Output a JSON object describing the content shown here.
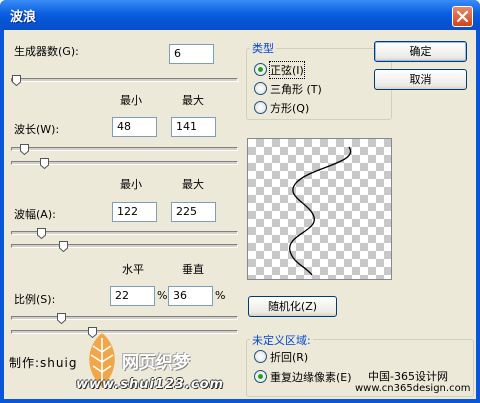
{
  "window": {
    "title": "波浪",
    "close_label": "X"
  },
  "generators": {
    "label": "生成器数(G):",
    "value": "6"
  },
  "headers": {
    "min": "最小",
    "max": "最大",
    "horizontal": "水平",
    "vertical": "垂直"
  },
  "wavelength": {
    "label": "波长(W):",
    "min": "48",
    "max": "141"
  },
  "amplitude": {
    "label": "波幅(A):",
    "min": "122",
    "max": "225"
  },
  "scale": {
    "label": "比例(S):",
    "horizontal": "22",
    "vertical": "36",
    "unit": "%"
  },
  "type_group": {
    "legend": "类型",
    "options": [
      {
        "label": "正弦(I)",
        "selected": true
      },
      {
        "label": "三角形 (T)",
        "selected": false
      },
      {
        "label": "方形(Q)",
        "selected": false
      }
    ]
  },
  "buttons": {
    "ok": "确定",
    "cancel": "取消",
    "randomize": "随机化(Z)"
  },
  "undefined_group": {
    "legend": "未定义区域:",
    "options": [
      {
        "label": "折回(R)",
        "selected": false
      },
      {
        "label": "重复边缘像素(E)",
        "selected": true
      }
    ]
  },
  "watermark": {
    "credit": "制作:shuig",
    "site_name": "网页织梦",
    "site_url": "www.shui123.com",
    "cn365_name": "中国-365设计网",
    "cn365_url": "www.cn365design.com"
  },
  "colors": {
    "title_bar": "#0a56d8",
    "dialog_bg": "#ece9d8",
    "radio_dot": "#21a121",
    "legend_text": "#0046d5"
  }
}
